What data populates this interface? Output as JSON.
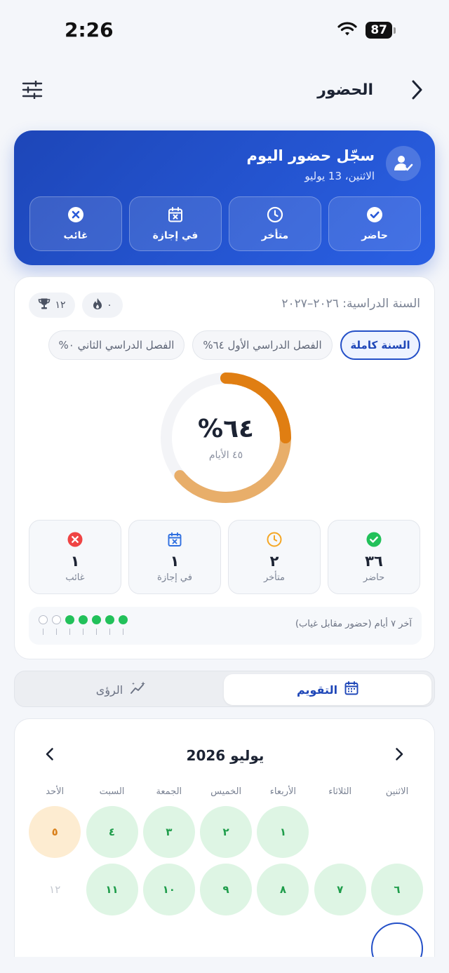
{
  "status_bar": {
    "time": "2:26",
    "battery": "87"
  },
  "header": {
    "title": "الحضور"
  },
  "record": {
    "title": "سجّل حضور اليوم",
    "date": "الاثنين، 13 يوليو",
    "buttons": [
      {
        "label": "حاضر",
        "icon": "check-circle-icon"
      },
      {
        "label": "متأخر",
        "icon": "clock-icon"
      },
      {
        "label": "في إجازة",
        "icon": "calendar-x-icon"
      },
      {
        "label": "غائب",
        "icon": "x-circle-icon"
      }
    ]
  },
  "summary": {
    "year_label": "السنة الدراسية: ٢٠٢٦–٢٠٢٧",
    "streak": "٠",
    "trophies": "١٢",
    "segments": [
      {
        "label": "السنة كاملة"
      },
      {
        "label": "الفصل الدراسي الأول ٦٤%"
      },
      {
        "label": "الفصل الدراسي الثاني ٠%"
      }
    ],
    "percent_text": "%٦٤",
    "percent_value": 64,
    "days_text": "٤٥ الأيام",
    "stats": [
      {
        "label": "حاضر",
        "value": "٣٦",
        "color": "#22c15a"
      },
      {
        "label": "متأخر",
        "value": "٢",
        "color": "#f4a623"
      },
      {
        "label": "في إجازة",
        "value": "١",
        "color": "#2f6fe0"
      },
      {
        "label": "غائب",
        "value": "١",
        "color": "#ef4444"
      }
    ],
    "week_label": "آخر ٧ أيام (حضور مقابل غياب)",
    "week_days": [
      "present",
      "present",
      "present",
      "present",
      "present",
      "empty",
      "empty"
    ]
  },
  "tabs": {
    "calendar": "التقويم",
    "insights": "الرؤى"
  },
  "calendar": {
    "month": "يوليو 2026",
    "weekdays": [
      "الاثنين",
      "الثلاثاء",
      "الأربعاء",
      "الخميس",
      "الجمعة",
      "السبت",
      "الأحد"
    ],
    "rows": [
      [
        {
          "label": "",
          "status": "blank"
        },
        {
          "label": "",
          "status": "blank"
        },
        {
          "label": "١",
          "status": "present"
        },
        {
          "label": "٢",
          "status": "present"
        },
        {
          "label": "٣",
          "status": "present"
        },
        {
          "label": "٤",
          "status": "present"
        },
        {
          "label": "٥",
          "status": "late"
        }
      ],
      [
        {
          "label": "٦",
          "status": "present"
        },
        {
          "label": "٧",
          "status": "present"
        },
        {
          "label": "٨",
          "status": "present"
        },
        {
          "label": "٩",
          "status": "present"
        },
        {
          "label": "١٠",
          "status": "present"
        },
        {
          "label": "١١",
          "status": "present"
        },
        {
          "label": "١٢",
          "status": "future"
        }
      ]
    ]
  },
  "colors": {
    "brand": "#2450c8",
    "ring_dark": "#e07e12",
    "ring_light": "#e8ae6a",
    "ring_track": "#f3f4f7",
    "present": "#22c15a",
    "late": "#f4a623"
  }
}
